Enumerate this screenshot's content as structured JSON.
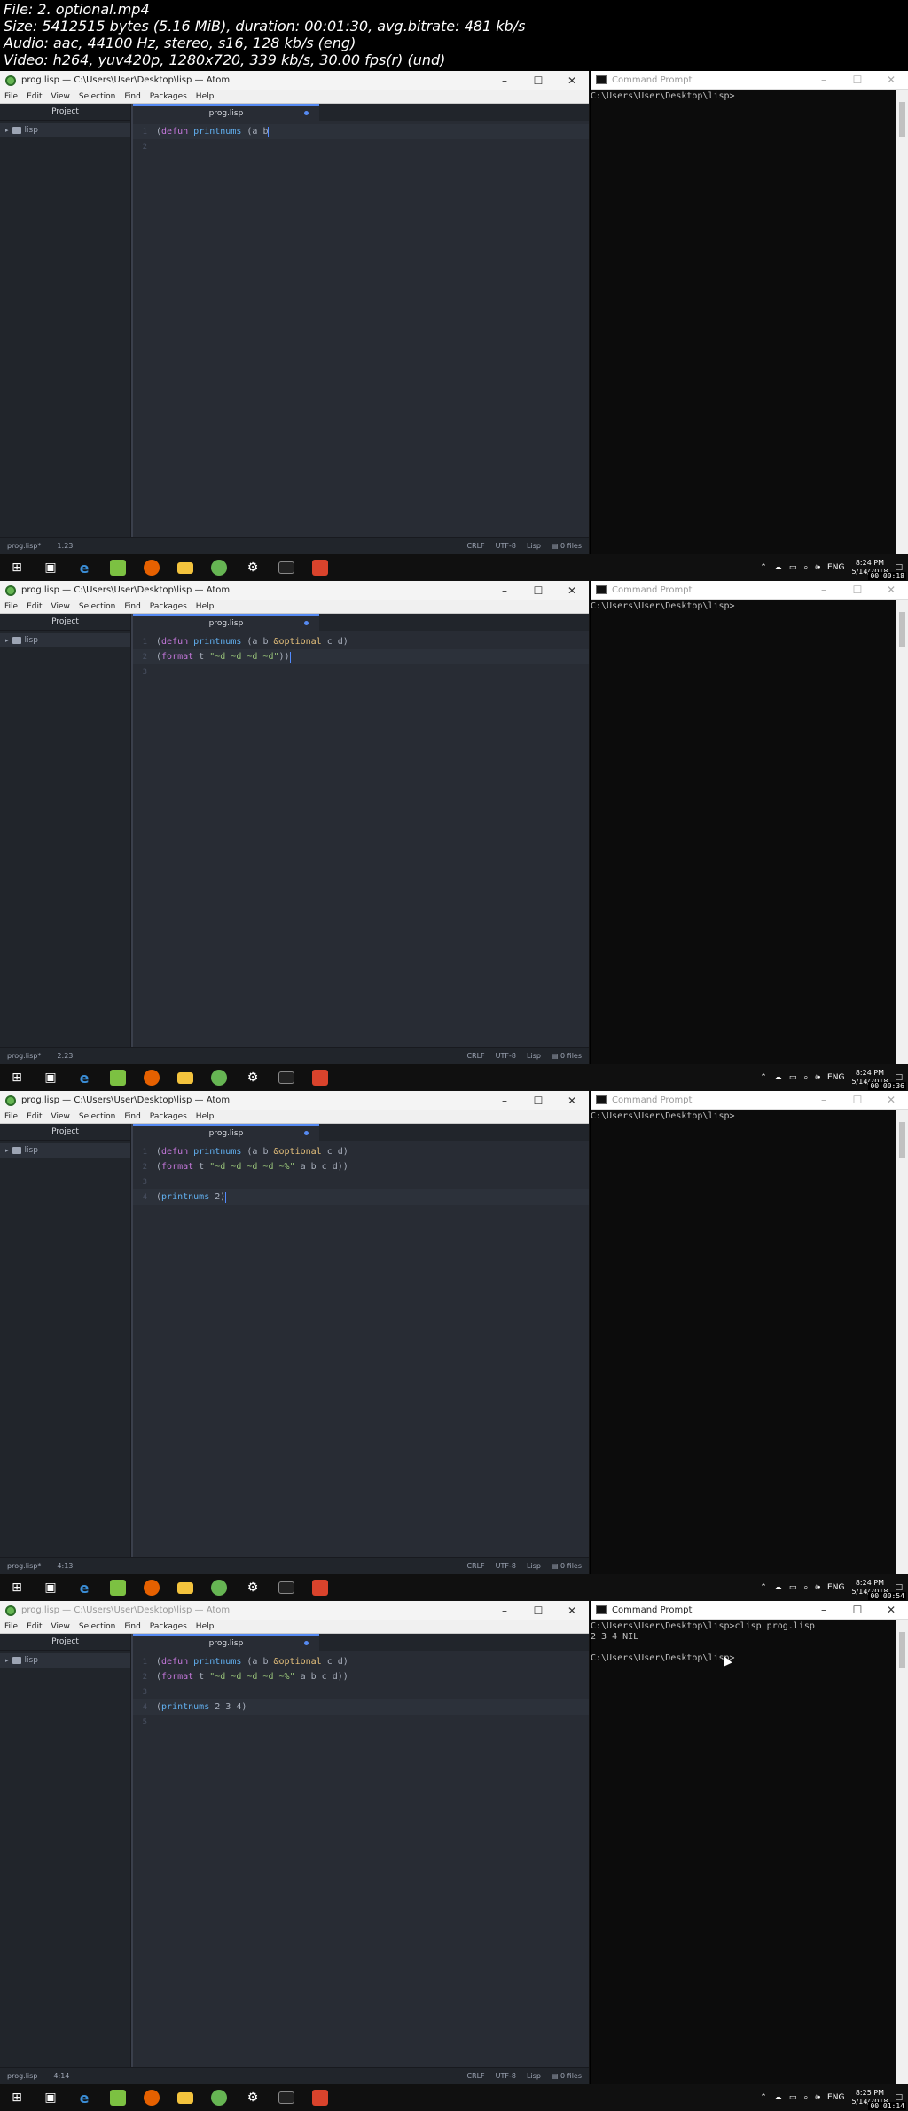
{
  "header": {
    "lines": [
      "File: 2. optional.mp4",
      "Size: 5412515 bytes (5.16 MiB), duration: 00:01:30, avg.bitrate: 481 kb/s",
      "Audio: aac, 44100 Hz, stereo, s16, 128 kb/s (eng)",
      "Video: h264, yuv420p, 1280x720, 339 kb/s, 30.00 fps(r) (und)"
    ]
  },
  "atom": {
    "title": "prog.lisp — C:\\Users\\User\\Desktop\\lisp — Atom",
    "menu": [
      "File",
      "Edit",
      "View",
      "Selection",
      "Find",
      "Packages",
      "Help"
    ],
    "tree_header": "Project",
    "folder": "lisp",
    "tab": "prog.lisp",
    "status_right": [
      "CRLF",
      "UTF-8",
      "Lisp",
      "0 files"
    ]
  },
  "cmd": {
    "title": "Command Prompt"
  },
  "taskbar": {
    "lang": "ENG",
    "date": "5/14/2018"
  },
  "frames": [
    {
      "status_file": "prog.lisp*",
      "status_pos": "1:23",
      "clock": "8:24 PM",
      "timecode": "00:00:18",
      "lines": [
        "(defun printnums (a b",
        ""
      ],
      "current_line": 1,
      "cmd_lines": [
        "C:\\Users\\User\\Desktop\\lisp>"
      ]
    },
    {
      "status_file": "prog.lisp*",
      "status_pos": "2:23",
      "clock": "8:24 PM",
      "timecode": "00:00:36",
      "lines": [
        "(defun printnums (a b &optional c d)",
        "(format t \"~d ~d ~d ~d\"))",
        ""
      ],
      "current_line": 2,
      "cmd_lines": [
        "C:\\Users\\User\\Desktop\\lisp>"
      ]
    },
    {
      "status_file": "prog.lisp*",
      "status_pos": "4:13",
      "clock": "8:24 PM",
      "timecode": "00:00:54",
      "lines": [
        "(defun printnums (a b &optional c d)",
        "(format t \"~d ~d ~d ~d ~%\" a b c d))",
        "",
        "(printnums 2)"
      ],
      "current_line": 4,
      "cmd_lines": [
        "C:\\Users\\User\\Desktop\\lisp>"
      ]
    },
    {
      "status_file": "prog.lisp",
      "status_pos": "4:14",
      "clock": "8:25 PM",
      "timecode": "00:01:14",
      "lines": [
        "(defun printnums (a b &optional c d)",
        "(format t \"~d ~d ~d ~d ~%\" a b c d))",
        "",
        "(printnums 2 3 4)",
        ""
      ],
      "current_line": 4,
      "cmd_lines": [
        "C:\\Users\\User\\Desktop\\lisp>clisp prog.lisp",
        "2 3 4 NIL",
        "",
        "C:\\Users\\User\\Desktop\\lisp>"
      ]
    }
  ]
}
